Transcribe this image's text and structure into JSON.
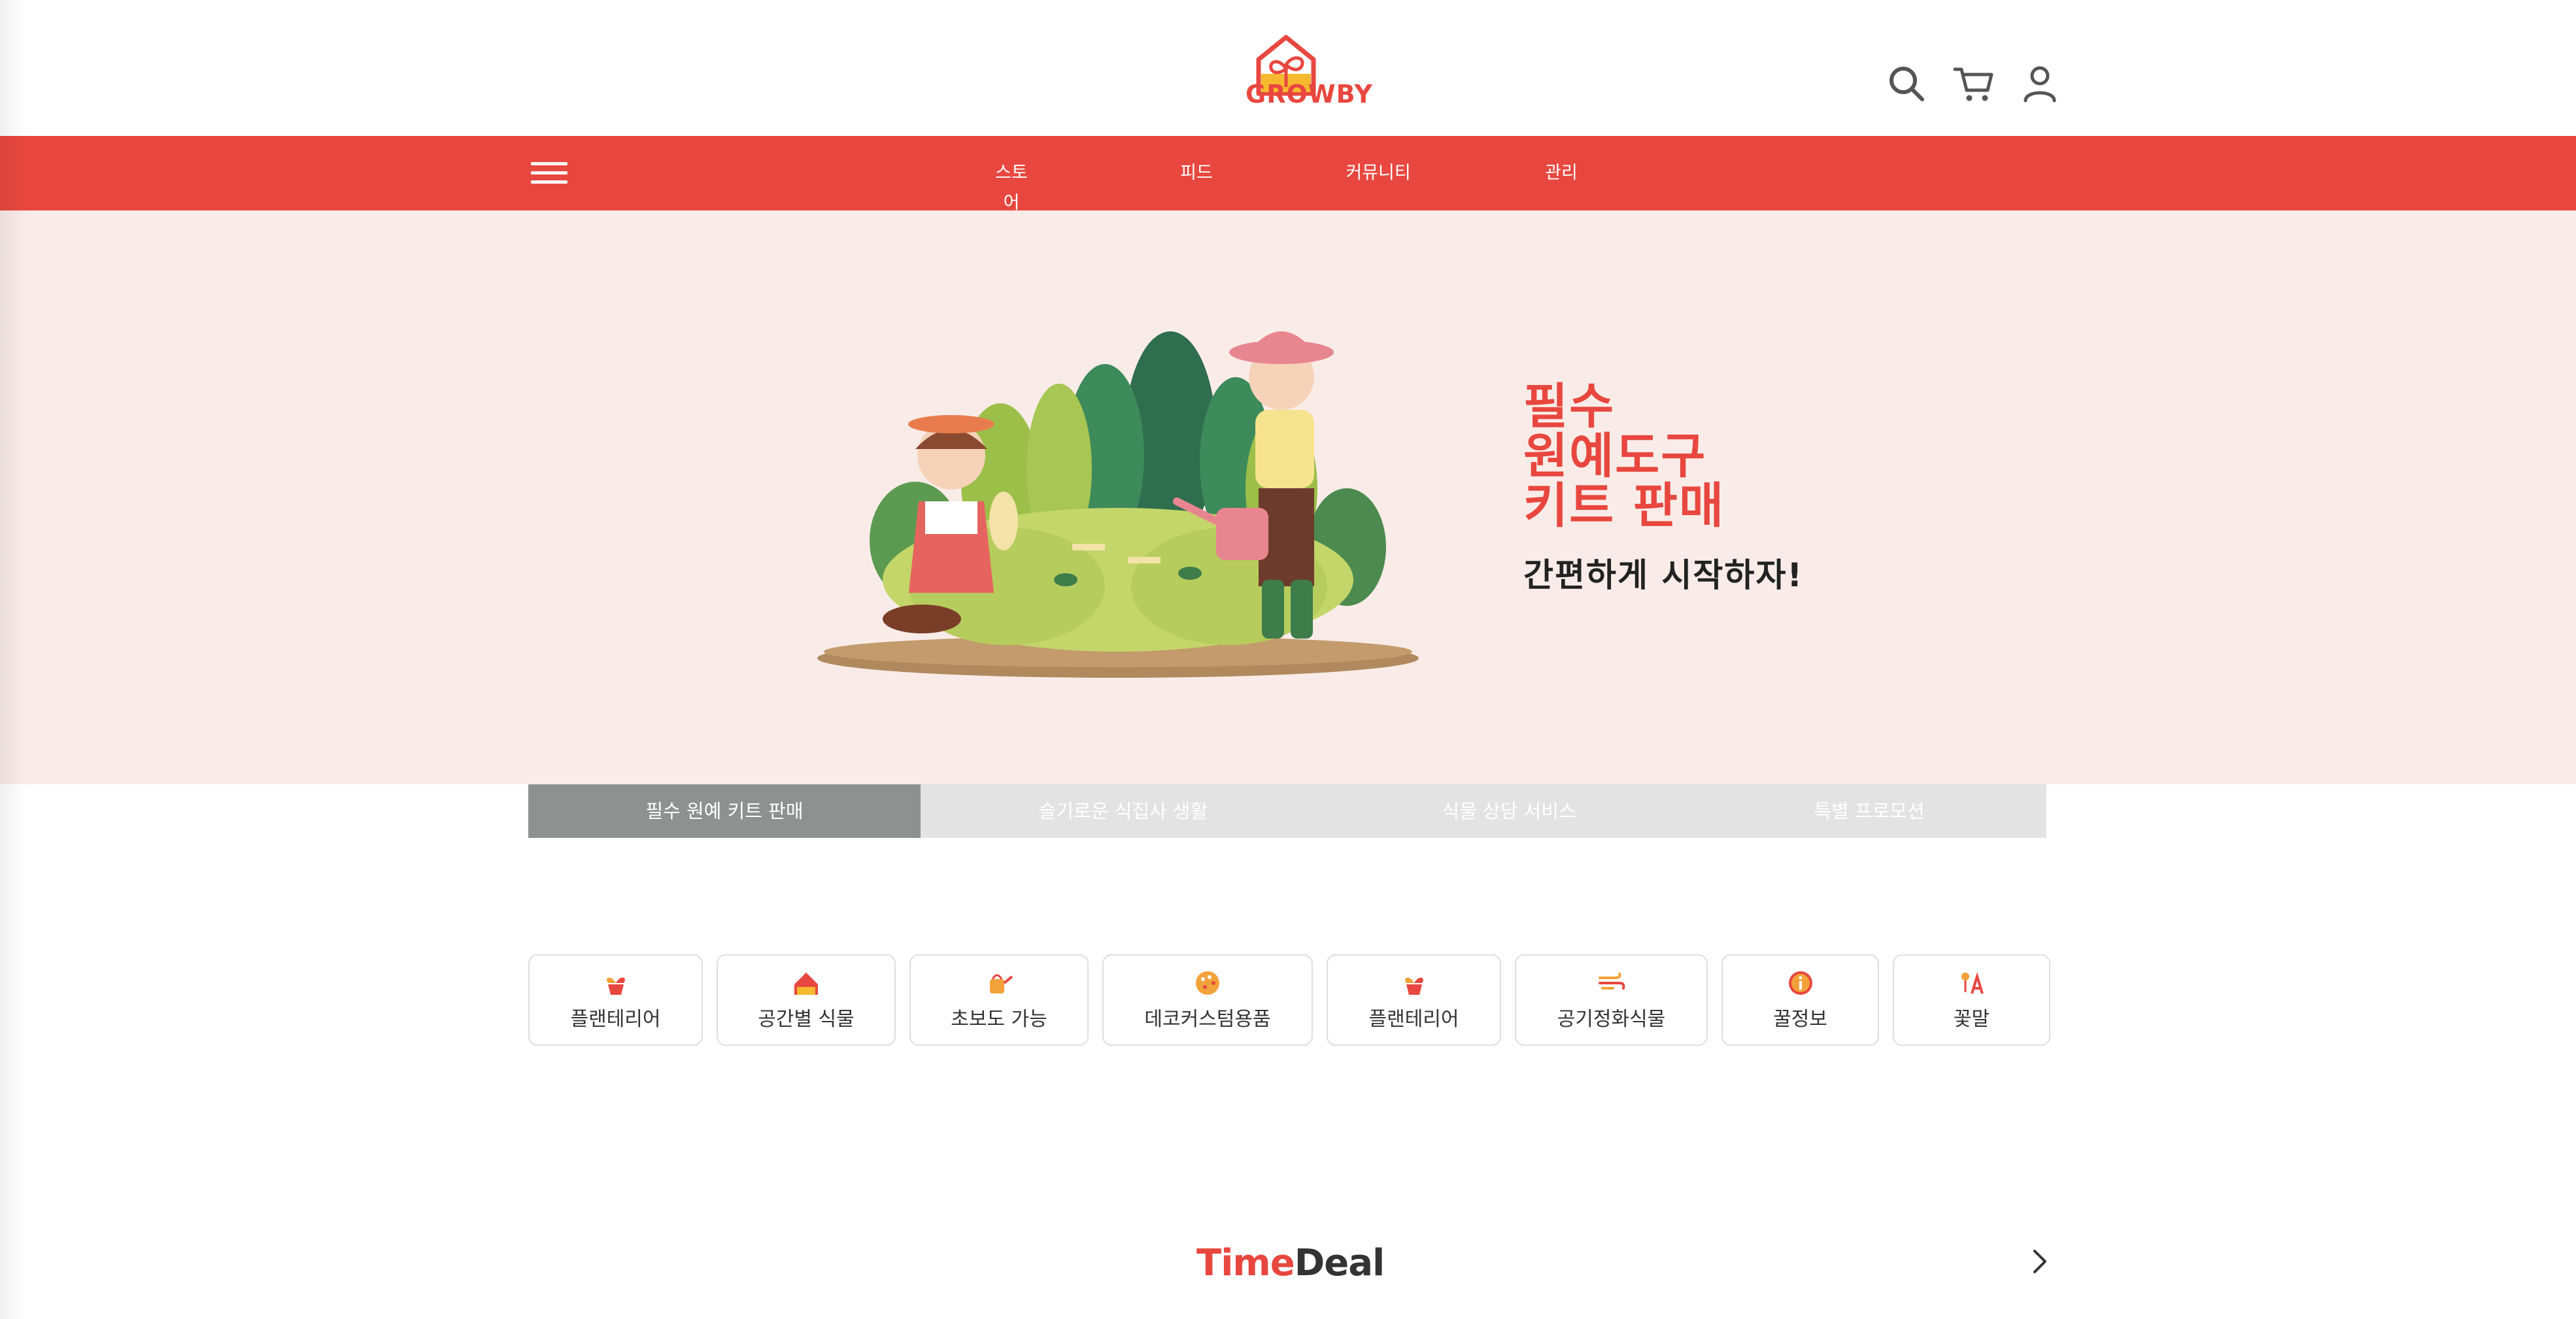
{
  "brand": {
    "name": "GROWBY",
    "accent_color": "#e8473f"
  },
  "header": {
    "icons": [
      "search-icon",
      "cart-icon",
      "user-icon"
    ]
  },
  "nav": {
    "menu_icon": "hamburger-menu-icon",
    "items": [
      "스토어",
      "피드",
      "커뮤니티",
      "관리"
    ]
  },
  "hero": {
    "title_lines": [
      "필수",
      "원예도구",
      "키트 판매"
    ],
    "subtitle": "간편하게 시작하자!"
  },
  "tabs": [
    {
      "label": "필수 원예 키트 판매",
      "active": true
    },
    {
      "label": "슬기로운 식집사 생활",
      "active": false
    },
    {
      "label": "식물 상담 서비스",
      "active": false
    },
    {
      "label": "특별 프로모션",
      "active": false
    }
  ],
  "categories": [
    {
      "label": "플랜테리어",
      "icon": "sprout-pot-icon"
    },
    {
      "label": "공간별 식물",
      "icon": "house-icon"
    },
    {
      "label": "초보도 가능",
      "icon": "watering-can-icon"
    },
    {
      "label": "데코커스텀용품",
      "icon": "palette-icon"
    },
    {
      "label": "플랜테리어",
      "icon": "sprout-pot-icon"
    },
    {
      "label": "공기정화식물",
      "icon": "wind-icon"
    },
    {
      "label": "꿀정보",
      "icon": "info-icon"
    },
    {
      "label": "꽃말",
      "icon": "flower-letter-icon"
    }
  ],
  "timedeal": {
    "title_part1": "Time",
    "title_part2": "Deal"
  }
}
